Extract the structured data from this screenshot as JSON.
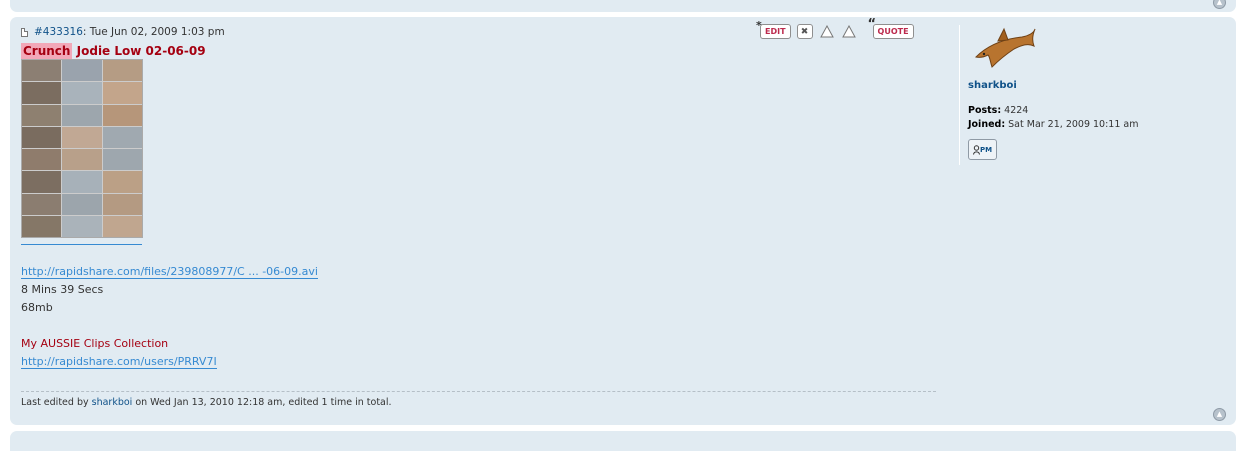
{
  "post": {
    "id_link": "#433316",
    "date_text": ": Tue Jun 02, 2009 1:03 pm",
    "title_highlight": "Crunch",
    "title_rest": " Jodie Low 02-06-09",
    "buttons": {
      "edit": "EDIT",
      "delete": "✖",
      "report": "!",
      "info": "?",
      "quote": "QUOTE"
    },
    "file_link": "http://rapidshare.com/files/239808977/C ... -06-09.avi",
    "duration": "8 Mins 39 Secs",
    "size": "68mb",
    "collection_label": "My AUSSIE Clips Collection",
    "collection_link": "http://rapidshare.com/users/PRRV7I",
    "edited_prefix": "Last edited by ",
    "edited_by": "sharkboi",
    "edited_suffix": " on Wed Jan 13, 2010 12:18 am, edited 1 time in total."
  },
  "profile": {
    "username": "sharkboi",
    "posts_label": "Posts:",
    "posts_value": " 4224",
    "joined_label": "Joined:",
    "joined_value": " Sat Mar 21, 2009 10:11 am",
    "pm_label": "PM"
  },
  "colors": {
    "post_bg": "#e1ebf2",
    "link": "#368ad2",
    "title": "#a50011",
    "username": "#105289"
  },
  "thumb_colors": [
    "#8c7f73",
    "#9aa3ad",
    "#b59c84",
    "#7b6d60",
    "#a9b3bb",
    "#c3a58b",
    "#8e8070",
    "#9da6ad",
    "#b6967a",
    "#7a6c5f",
    "#c1a894",
    "#a0a9b0",
    "#8f7c6c",
    "#b8a08a",
    "#9ea7ae",
    "#7c6e61",
    "#a7b1b9",
    "#bba086",
    "#8b7d70",
    "#9ca5ac",
    "#b49a82",
    "#857767",
    "#aab3ba",
    "#c0a68f"
  ]
}
